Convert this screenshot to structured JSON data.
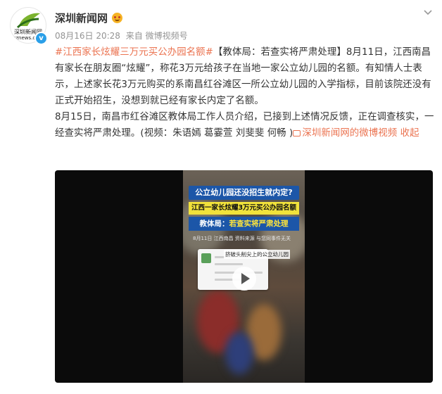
{
  "account": {
    "name": "深圳新闻网",
    "avatar_cn": "深圳新闻网",
    "avatar_en": "sznews.com",
    "date": "08月16日 20:28",
    "source": "来自 微博视频号"
  },
  "post": {
    "hashtag": "#江西家长炫耀三万元买公办园名额#",
    "para1": "【教体局：若查实将严肃处理】8月11日，江西南昌有家长在朋友圈“炫耀”，称花3万元给孩子在当地一家公立幼儿园的名额。有知情人士表示，上述家长花3万元购买的系南昌红谷滩区一所公立幼儿园的入学指标，目前该院还没有正式开始招生，没想到就已经有家长内定了名额。",
    "para2": "8月15日，南昌市红谷滩区教体局工作人员介绍，已接到上述情况反馈，正在调查核实，一经查实将严肃处理。(视频：朱语嫣 葛霎萱 刘斐斐 何畅 )",
    "video_link": "深圳新闻网的微博视频",
    "collapse": "收起"
  },
  "video": {
    "headline1": "公立幼儿园还没招生就内定?",
    "headline2": "江西一家长炫耀3万元买公办园名额",
    "headline3_prefix": "教体局：",
    "headline3_highlight": "若查实将严肃处理",
    "subline": "8月11日  江西南昌        资料来源 与您同事件无关",
    "chat_caption": "挤破头削尖上的公立幼儿园"
  },
  "colors": {
    "accent": "#eb7350",
    "verify_blue": "#2a9fe8",
    "video_bg": "#0b0b0b"
  }
}
